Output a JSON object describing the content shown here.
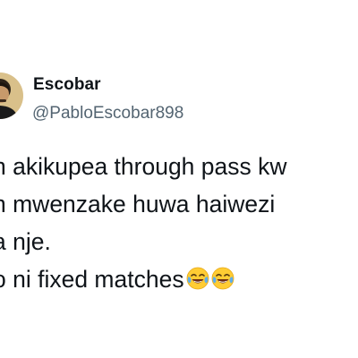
{
  "tweet": {
    "author": {
      "display_name": "Escobar",
      "handle": "@PabloEscobar898",
      "avatar_icon": "profile-photo"
    },
    "body": {
      "lines": [
        "n akikupea through pass kw",
        "n mwenzake huwa haiwezi",
        "a nje.",
        "o ni fixed matches"
      ],
      "trailing_emojis": [
        "face-with-tears-of-joy",
        "face-with-tears-of-joy"
      ]
    }
  },
  "colors": {
    "background": "#ffffff",
    "text_primary": "#0f1419",
    "text_secondary": "#536471",
    "emoji_face": "#ffcc33",
    "emoji_tears": "#5dadec"
  }
}
